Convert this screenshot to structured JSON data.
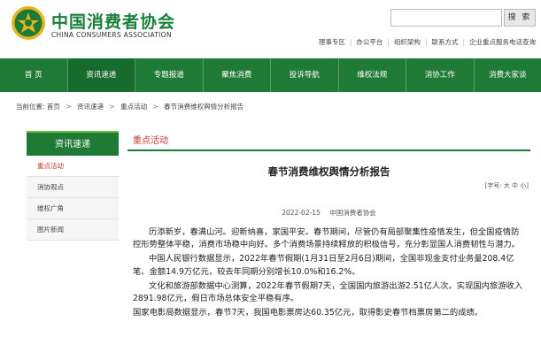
{
  "header": {
    "org_name_cn": "中国消费者协会",
    "org_name_en": "CHINA CONSUMERS ASSOCIATION",
    "search_button": "搜 索",
    "toplinks": [
      "理事专区",
      "办公平台",
      "组织架构",
      "联系方式",
      "企业重点服务电话查询"
    ]
  },
  "nav": {
    "items": [
      "首 页",
      "资讯速递",
      "专题报道",
      "聚焦消费",
      "投诉导航",
      "维权法规",
      "消协工作",
      "消费大家谈"
    ]
  },
  "breadcrumb": {
    "label": "当前位置:",
    "items": [
      "首页",
      "资讯速递",
      "重点活动",
      "春节消费维权舆情分析报告"
    ]
  },
  "sidebar": {
    "title": "资讯速递",
    "items": [
      {
        "label": "重点活动",
        "active": true
      },
      {
        "label": "消协观点",
        "active": false
      },
      {
        "label": "维权广角",
        "active": false
      },
      {
        "label": "图片新闻",
        "active": false
      }
    ]
  },
  "main": {
    "section_title": "重点活动",
    "article_title": "春节消费维权舆情分析报告",
    "font_size_control": "[字号: 大 中 小]",
    "date": "2022-02-15",
    "source": "中国消费者协会",
    "paragraphs": [
      "历添新岁，春满山河。迎新纳喜，家国平安。春节期间，尽管仍有局部聚集性疫情发生，但全国疫情防控形势整体平稳，消费市场稳中向好。多个消费场景持续释放的积极信号，充分彰显国人消费韧性与潜力。",
      "中国人民银行数据显示，2022年春节假期(1月31日至2月6日)期间，全国非现金支付业务量208.4亿笔、金额14.9万亿元，较去年同期分别增长10.0%和16.2%。",
      "文化和旅游部数据中心测算，2022年春节假期7天，全国国内旅游出游2.51亿人次。实现国内旅游收入2891.98亿元，假日市场总体安全平稳有序。",
      "国家电影局数据显示，春节7天，我国电影票房达60.35亿元，取得影史春节档票房第二的成绩。"
    ]
  }
}
